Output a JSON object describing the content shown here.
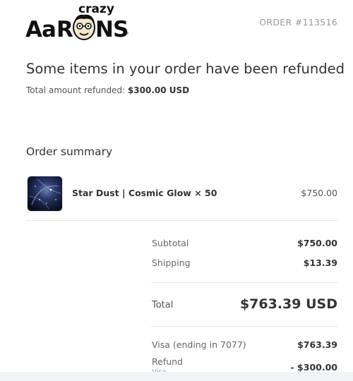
{
  "brand": {
    "name": "Crazy Aaron's",
    "logo_top_text": "crazy",
    "logo_main_text": "AaRONS",
    "colors": {
      "ink": "#111111",
      "text": "#333333",
      "muted": "#999999"
    }
  },
  "header": {
    "order_number": "ORDER #113516"
  },
  "message": {
    "headline": "Some items in your order have been refunded",
    "refunded_label": "Total amount refunded:",
    "refunded_amount": "$300.00 USD"
  },
  "summary": {
    "title": "Order summary",
    "items": [
      {
        "title": "Star Dust | Cosmic Glow × 50",
        "price": "$750.00",
        "thumbnail_icon": "cosmic-putty-thumbnail"
      }
    ]
  },
  "totals": {
    "subtotal_label": "Subtotal",
    "subtotal_value": "$750.00",
    "shipping_label": "Shipping",
    "shipping_value": "$13.39",
    "total_label": "Total",
    "total_value": "$763.39 USD",
    "payments": [
      {
        "label": "Visa (ending in 7077)",
        "value": "$763.39"
      },
      {
        "label": "Refund",
        "sub_label": "Visa",
        "value": "- $300.00"
      }
    ]
  }
}
